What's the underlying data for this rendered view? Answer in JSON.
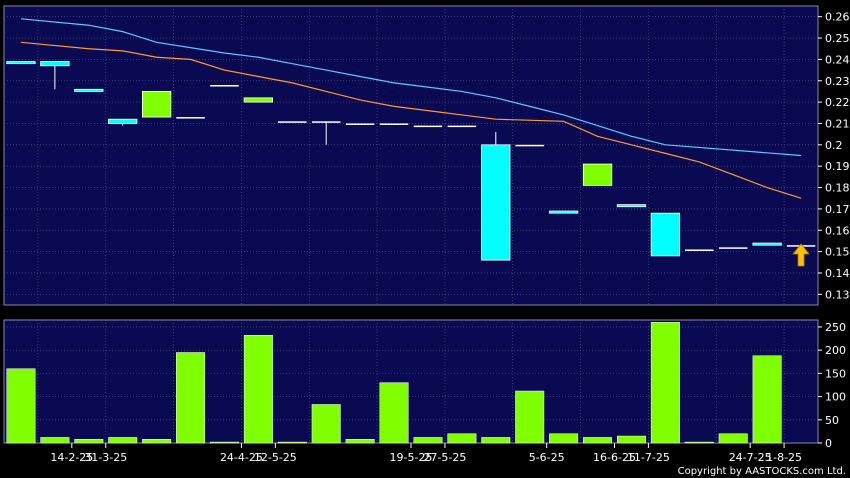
{
  "chart_data": {
    "type": "candlestick",
    "price_axis": {
      "range": [
        0.125,
        0.265
      ],
      "ticks": [
        0.13,
        0.14,
        0.15,
        0.16,
        0.17,
        0.18,
        0.19,
        0.2,
        0.21,
        0.22,
        0.23,
        0.24,
        0.25,
        0.26
      ]
    },
    "volume_axis": {
      "range": [
        0,
        265
      ],
      "ticks": [
        0,
        50,
        100,
        150,
        200,
        250
      ]
    },
    "x_tick_labels": [
      {
        "i": 1.5,
        "label": "14-2-25"
      },
      {
        "i": 2.5,
        "label": "31-3-25"
      },
      {
        "i": 6.5,
        "label": "24-4-25"
      },
      {
        "i": 7.5,
        "label": "12-5-25"
      },
      {
        "i": 11.5,
        "label": "19-5-25"
      },
      {
        "i": 12.5,
        "label": "27-5-25"
      },
      {
        "i": 15.5,
        "label": "5-6-25"
      },
      {
        "i": 17.5,
        "label": "16-6-25"
      },
      {
        "i": 18.5,
        "label": "11-7-25"
      },
      {
        "i": 21.5,
        "label": "24-7-25"
      },
      {
        "i": 22.5,
        "label": "1-8-25"
      }
    ],
    "candles": [
      {
        "o": 0.239,
        "c": 0.238,
        "h": 0.239,
        "l": 0.238
      },
      {
        "o": 0.239,
        "c": 0.237,
        "h": 0.239,
        "l": 0.226
      },
      {
        "o": 0.226,
        "c": 0.225,
        "h": 0.226,
        "l": 0.225
      },
      {
        "o": 0.212,
        "c": 0.21,
        "h": 0.212,
        "l": 0.209
      },
      {
        "o": 0.213,
        "c": 0.225,
        "h": 0.225,
        "l": 0.213
      },
      {
        "o": 0.213,
        "c": 0.213,
        "h": 0.213,
        "l": 0.213
      },
      {
        "o": 0.228,
        "c": 0.228,
        "h": 0.228,
        "l": 0.228
      },
      {
        "o": 0.22,
        "c": 0.222,
        "h": 0.222,
        "l": 0.22
      },
      {
        "o": 0.211,
        "c": 0.211,
        "h": 0.211,
        "l": 0.211
      },
      {
        "o": 0.211,
        "c": 0.211,
        "h": 0.211,
        "l": 0.2
      },
      {
        "o": 0.21,
        "c": 0.21,
        "h": 0.21,
        "l": 0.21
      },
      {
        "o": 0.21,
        "c": 0.21,
        "h": 0.21,
        "l": 0.21
      },
      {
        "o": 0.209,
        "c": 0.209,
        "h": 0.209,
        "l": 0.209
      },
      {
        "o": 0.209,
        "c": 0.209,
        "h": 0.209,
        "l": 0.209
      },
      {
        "o": 0.2,
        "c": 0.146,
        "h": 0.206,
        "l": 0.146
      },
      {
        "o": 0.2,
        "c": 0.2,
        "h": 0.2,
        "l": 0.2
      },
      {
        "o": 0.169,
        "c": 0.168,
        "h": 0.169,
        "l": 0.168
      },
      {
        "o": 0.181,
        "c": 0.191,
        "h": 0.191,
        "l": 0.181
      },
      {
        "o": 0.172,
        "c": 0.171,
        "h": 0.172,
        "l": 0.171
      },
      {
        "o": 0.168,
        "c": 0.148,
        "h": 0.168,
        "l": 0.148
      },
      {
        "o": 0.151,
        "c": 0.151,
        "h": 0.151,
        "l": 0.151
      },
      {
        "o": 0.152,
        "c": 0.152,
        "h": 0.152,
        "l": 0.152
      },
      {
        "o": 0.154,
        "c": 0.153,
        "h": 0.154,
        "l": 0.153
      },
      {
        "o": 0.153,
        "c": 0.153,
        "h": 0.153,
        "l": 0.153
      }
    ],
    "volumes": [
      160,
      12,
      8,
      12,
      8,
      195,
      2,
      232,
      2,
      83,
      8,
      130,
      12,
      20,
      12,
      112,
      20,
      12,
      15,
      260,
      2,
      20,
      188,
      0
    ],
    "series": [
      {
        "values": [
          0.259,
          0.256,
          0.253,
          0.248,
          0.243,
          0.241,
          0.238,
          0.235,
          0.232,
          0.229,
          0.227,
          0.225,
          0.222,
          0.218,
          0.214,
          0.209,
          0.204,
          0.2,
          0.195
        ],
        "x_index": [
          0,
          2,
          3,
          4,
          6,
          7,
          8,
          9,
          10,
          11,
          12,
          13,
          14,
          15,
          16,
          17,
          18,
          19,
          23
        ]
      },
      {
        "values": [
          0.248,
          0.245,
          0.244,
          0.241,
          0.24,
          0.235,
          0.232,
          0.229,
          0.225,
          0.221,
          0.218,
          0.216,
          0.214,
          0.212,
          0.211,
          0.204,
          0.2,
          0.196,
          0.192,
          0.186,
          0.18,
          0.175
        ],
        "x_index": [
          0,
          2,
          3,
          4,
          5,
          6,
          7,
          8,
          9,
          10,
          11,
          12,
          13,
          14,
          16,
          17,
          18,
          19,
          20,
          21,
          22,
          23
        ]
      }
    ],
    "colors": {
      "panel_bg": "#0a0a52",
      "grid": "#5a5a7a",
      "up": "#7fff00",
      "down": "#00ffff",
      "ma_fast": "#5fc8ff",
      "ma_slow": "#ff9a2e",
      "volume": "#7fff00",
      "arrow": "#ffc000"
    },
    "marker": {
      "type": "up-arrow",
      "i": 23,
      "price": 0.147
    }
  },
  "footer": {
    "copyright": "Copyright by AASTOCKS.com Ltd."
  }
}
